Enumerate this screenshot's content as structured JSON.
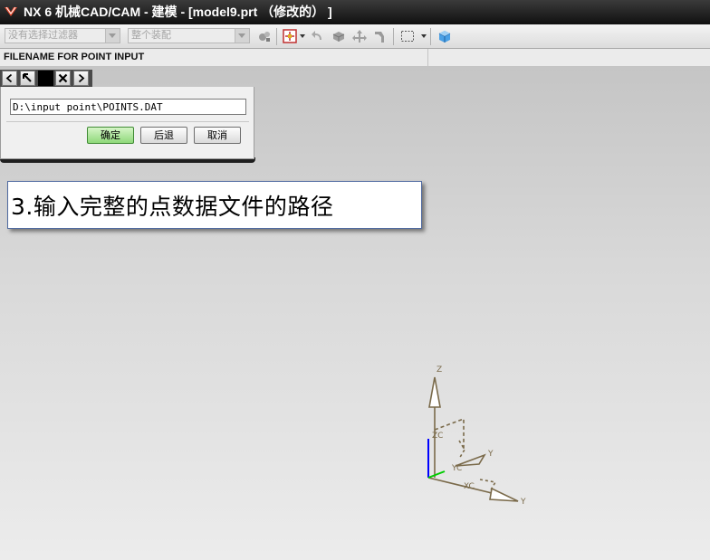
{
  "window": {
    "title": "NX 6 机械CAD/CAM - 建模 - [model9.prt （修改的） ]"
  },
  "toolbar": {
    "filter_combo": "没有选择过滤器",
    "assembly_combo": "整个装配"
  },
  "cue_line": {
    "text": "FILENAME FOR POINT INPUT"
  },
  "dialog": {
    "file_path_value": "D:\\input point\\POINTS.DAT",
    "ok_label": "确定",
    "back_label": "后退",
    "cancel_label": "取消"
  },
  "annotation": {
    "text": "3.输入完整的点数据文件的路径"
  },
  "triad": {
    "labels": {
      "z": "Z",
      "zc": "ZC",
      "y": "Y",
      "yc": "YC",
      "xc": "XC",
      "x": "Y"
    }
  },
  "colors": {
    "title_bar": "#1a1a1a",
    "ok_button": "#8fd97a",
    "triad_axis": "#7a6a4a",
    "wcs_z": "#0000ff",
    "wcs_y": "#00cc00"
  }
}
